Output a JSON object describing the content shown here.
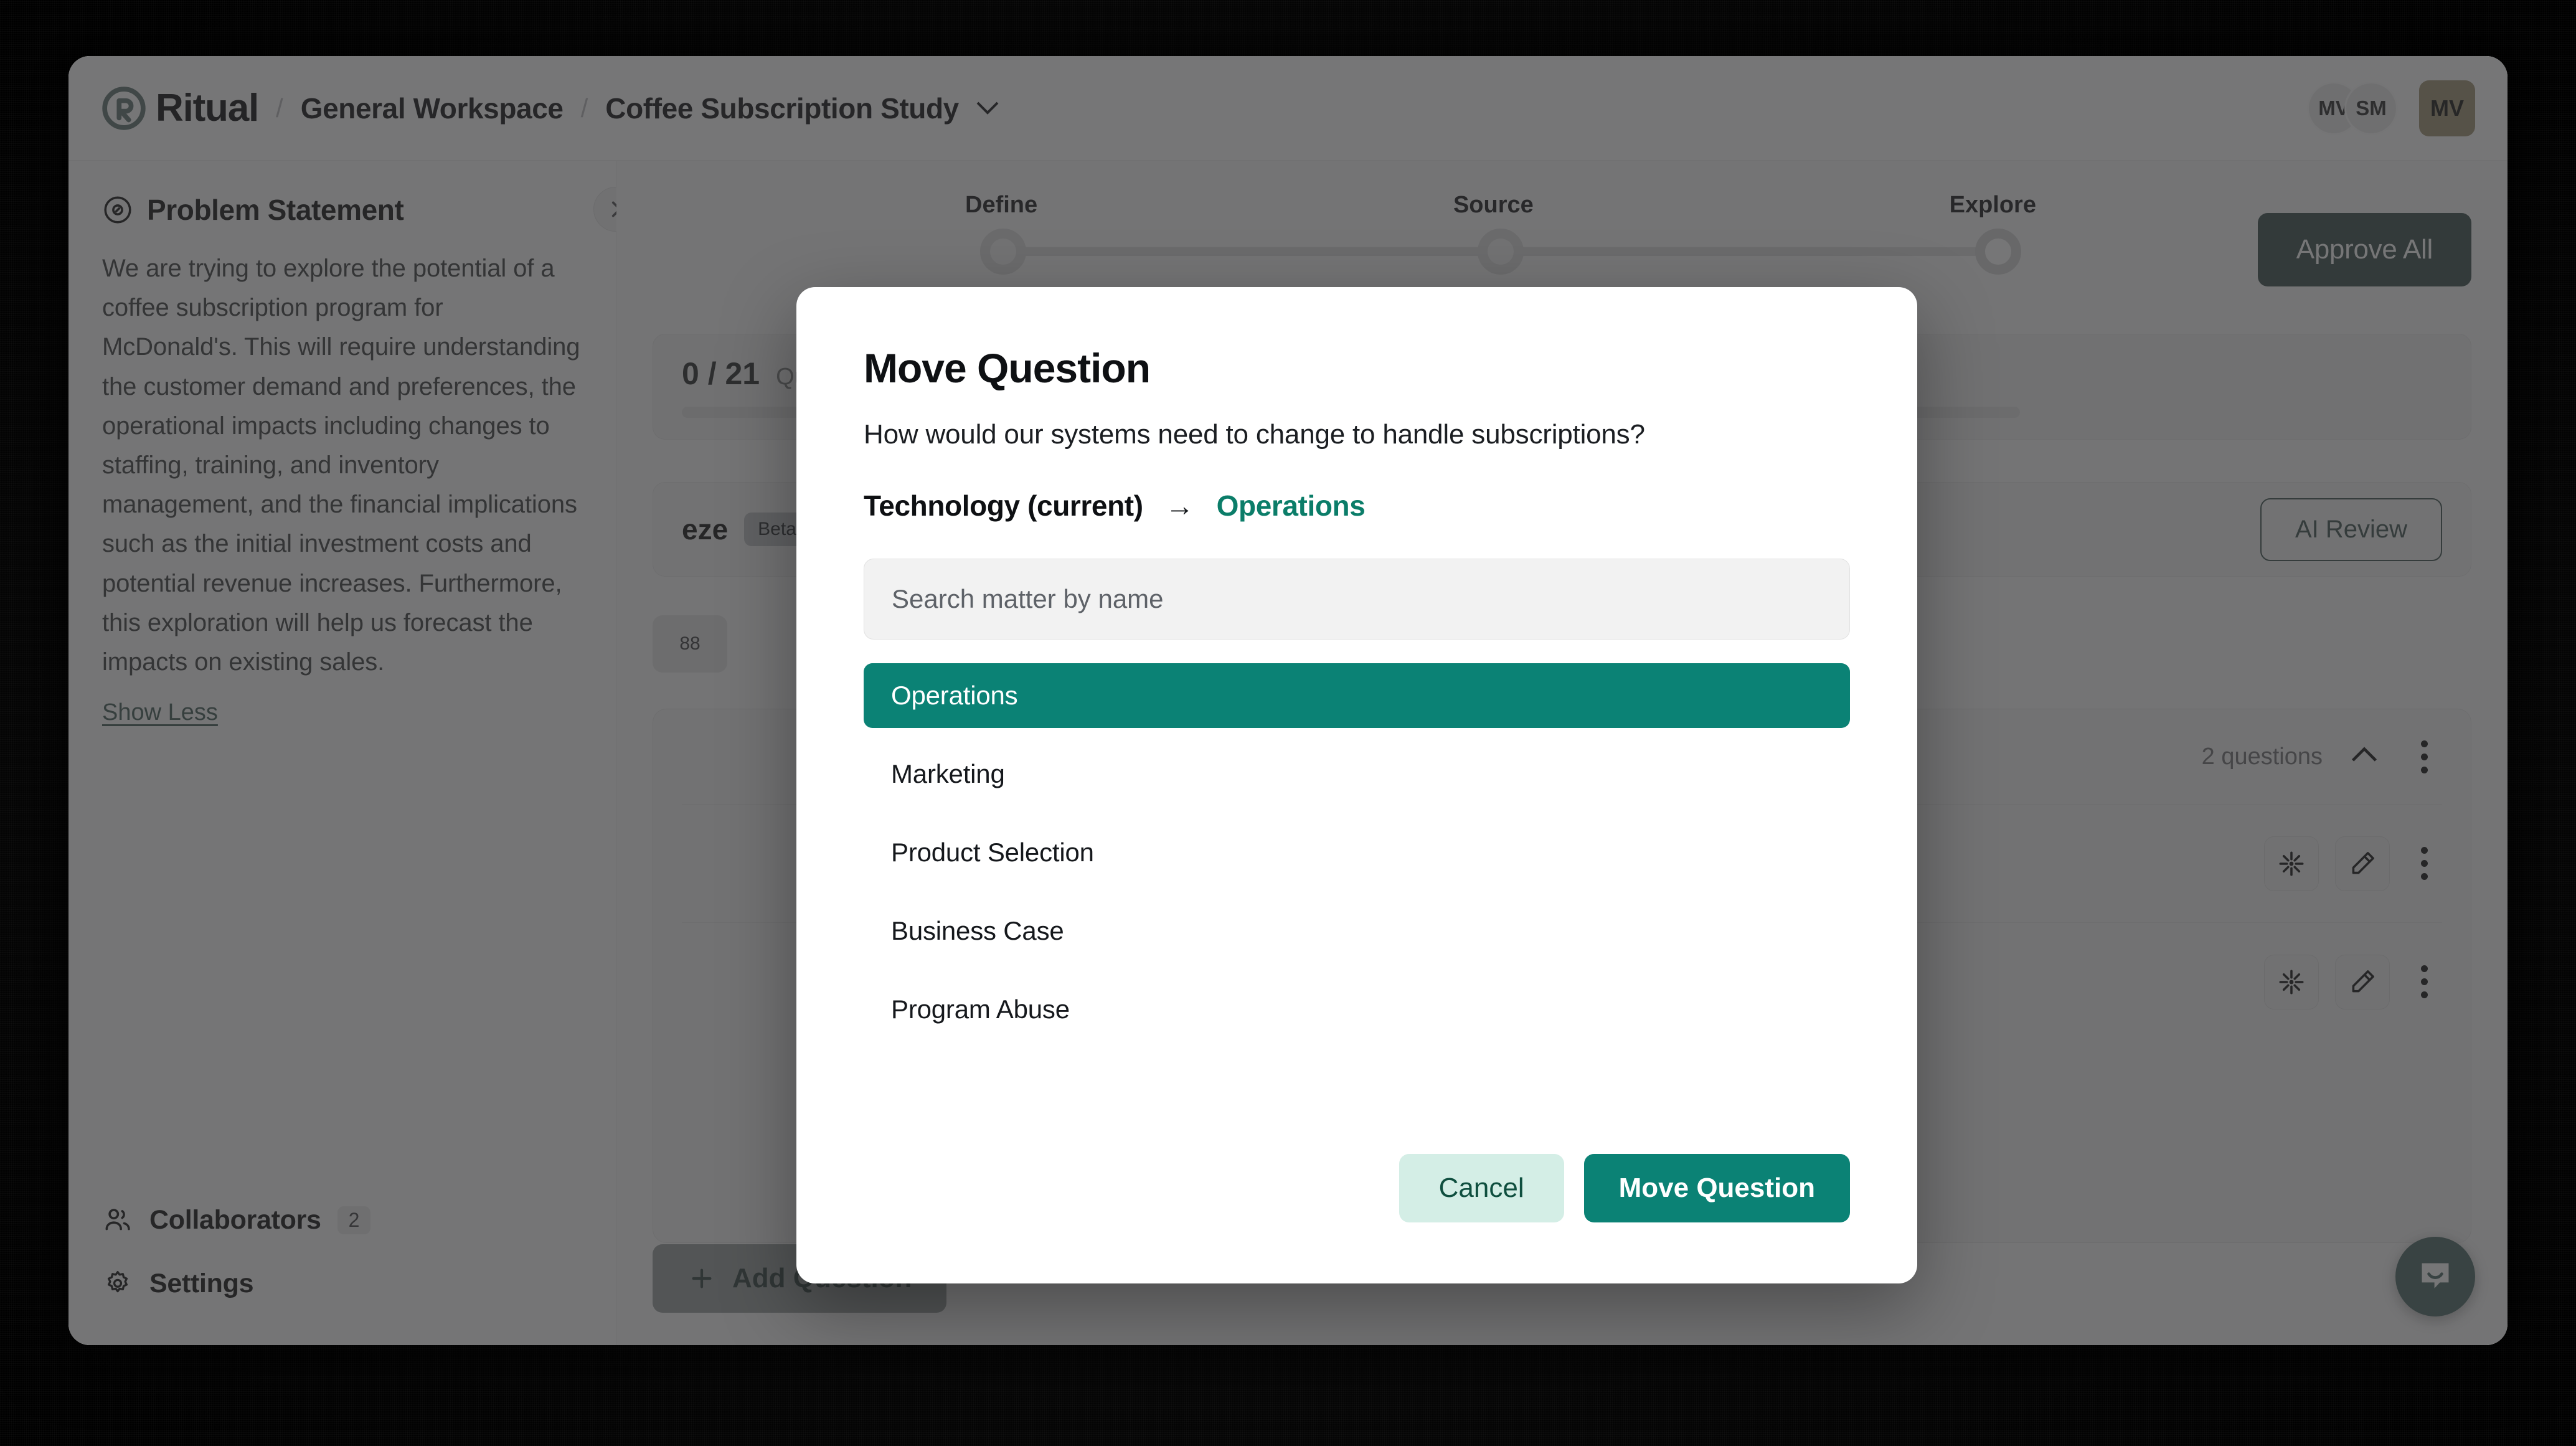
{
  "brand": {
    "name": "Ritual",
    "accent_green": "#0b8275",
    "deep_green": "#105c4f",
    "gold": "#c89219"
  },
  "topbar": {
    "breadcrumb": [
      {
        "label": "General Workspace"
      },
      {
        "label": "Coffee Subscription Study"
      }
    ],
    "separator": "/",
    "caret_icon": "chevron-down-icon",
    "avatars": [
      {
        "initials": "MV",
        "shape": "circle"
      },
      {
        "initials": "SM",
        "shape": "circle"
      }
    ],
    "account_avatar": {
      "initials": "MV",
      "shape": "square"
    }
  },
  "sidebar": {
    "problem_statement": {
      "icon": "compass-icon",
      "title": "Problem Statement",
      "body": "We are trying to explore the potential of a coffee subscription program for McDonald's. This will require understanding the customer demand and preferences, the operational impacts including changes to staffing, training, and inventory management, and the financial implications such as the initial investment costs and potential revenue increases. Furthermore, this exploration will help us forecast the impacts on existing sales.",
      "toggle_label": "Show Less"
    },
    "collapse_icon": "chevron-right-icon",
    "items": [
      {
        "icon": "users-icon",
        "label": "Collaborators",
        "badge": "2"
      },
      {
        "icon": "gear-icon",
        "label": "Settings",
        "badge": ""
      }
    ]
  },
  "main": {
    "stepper": {
      "steps": [
        "Define",
        "Source",
        "Explore"
      ]
    },
    "approve_all_label": "Approve All",
    "assignment": {
      "count": "0 / 21",
      "text": "Questions assigned"
    },
    "section": {
      "title_fragment": "eze",
      "beta_label": "Beta",
      "ai_review_label": "AI Review"
    },
    "filter_chip_label": "88",
    "group": {
      "count_label": "2 questions",
      "collapse_icon": "chevron-up-icon",
      "menu_icon": "kebab-menu-icon",
      "rows": [
        {
          "sparkle_icon": "sparkle-icon",
          "edit_icon": "pencil-icon",
          "menu_icon": "kebab-menu-icon"
        },
        {
          "sparkle_icon": "sparkle-icon",
          "edit_icon": "pencil-icon",
          "menu_icon": "kebab-menu-icon"
        }
      ]
    },
    "add_question_label": "Add Question",
    "add_question_icon": "plus-icon",
    "intercom_icon": "chat-bubble-icon"
  },
  "modal": {
    "title": "Move Question",
    "question": "How would our systems need to change to handle subscriptions?",
    "path": {
      "from": "Technology (current)",
      "arrow": "→",
      "to": "Operations"
    },
    "search": {
      "placeholder": "Search matter by name",
      "value": ""
    },
    "matters": [
      {
        "label": "Operations",
        "selected": true
      },
      {
        "label": "Marketing",
        "selected": false
      },
      {
        "label": "Product Selection",
        "selected": false
      },
      {
        "label": "Business Case",
        "selected": false
      },
      {
        "label": "Program Abuse",
        "selected": false
      }
    ],
    "cancel_label": "Cancel",
    "confirm_label": "Move Question"
  }
}
